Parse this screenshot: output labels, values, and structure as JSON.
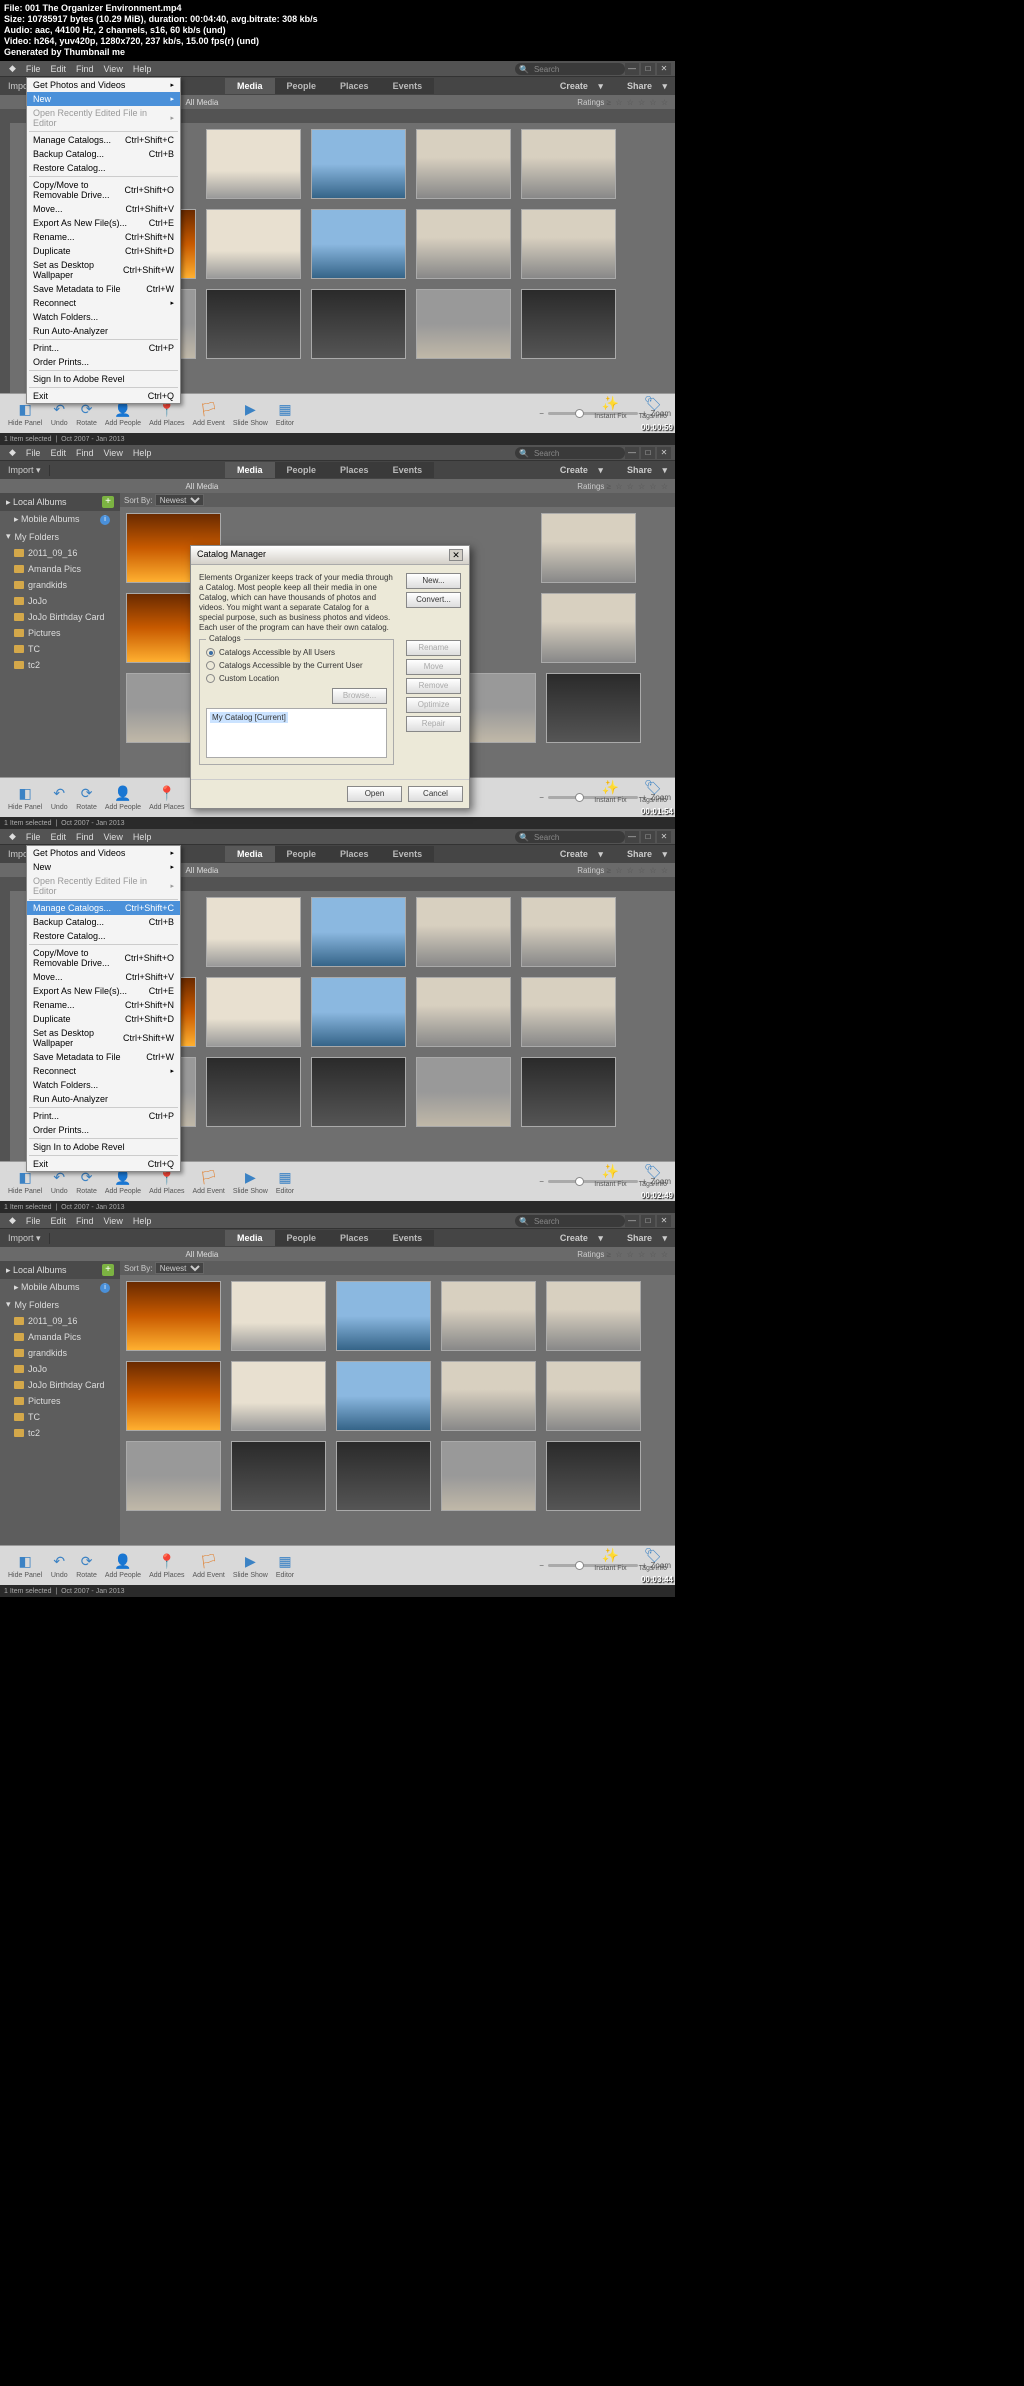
{
  "header": {
    "l1": "File: 001 The Organizer Environment.mp4",
    "l2": "Size: 10785917 bytes (10.29 MiB), duration: 00:04:40, avg.bitrate: 308 kb/s",
    "l3": "Audio: aac, 44100 Hz, 2 channels, s16, 60 kb/s (und)",
    "l4": "Video: h264, yuv420p, 1280x720, 237 kb/s, 15.00 fps(r) (und)",
    "l5": "Generated by Thumbnail me"
  },
  "menubar": {
    "file": "File",
    "edit": "Edit",
    "find": "Find",
    "view": "View",
    "help": "Help"
  },
  "search": {
    "placeholder": "Search"
  },
  "topbar": {
    "import": "Import",
    "create": "Create",
    "share": "Share"
  },
  "tabs": {
    "media": "Media",
    "people": "People",
    "places": "Places",
    "events": "Events"
  },
  "subbar": {
    "allmedia": "All Media",
    "ratings": "Ratings",
    "stars": "≥ ☆ ☆ ☆ ☆ ☆"
  },
  "sortby": {
    "label": "Sort By:",
    "value": "Newest"
  },
  "sidebar": {
    "local": "Local Albums",
    "mobile": "Mobile Albums",
    "myfolders": "My Folders",
    "items": [
      "2011_09_16",
      "Amanda Pics",
      "grandkids",
      "JoJo",
      "JoJo Birthday Card",
      "Pictures",
      "TC",
      "tc2"
    ]
  },
  "toolbar": {
    "hidepanel": "Hide Panel",
    "undo": "Undo",
    "rotate": "Rotate",
    "addpeople": "Add People",
    "addplaces": "Add Places",
    "addevent": "Add Event",
    "slideshow": "Slide Show",
    "editor": "Editor",
    "zoom": "Zoom",
    "instantfix": "Instant Fix",
    "tagsinfo": "Tags/Info"
  },
  "status": {
    "selected": "1 Item selected",
    "range": "Oct 2007 - Jan 2013"
  },
  "filemenu": {
    "getphotos": "Get Photos and Videos",
    "new": "New",
    "openrecent": "Open Recently Edited File in Editor",
    "manage": "Manage Catalogs...",
    "manage_sc": "Ctrl+Shift+C",
    "backup": "Backup Catalog...",
    "backup_sc": "Ctrl+B",
    "restore": "Restore Catalog...",
    "copymove": "Copy/Move to Removable Drive...",
    "copymove_sc": "Ctrl+Shift+O",
    "move": "Move...",
    "move_sc": "Ctrl+Shift+V",
    "export": "Export As New File(s)...",
    "export_sc": "Ctrl+E",
    "rename": "Rename...",
    "rename_sc": "Ctrl+Shift+N",
    "duplicate": "Duplicate",
    "duplicate_sc": "Ctrl+Shift+D",
    "wallpaper": "Set as Desktop Wallpaper",
    "wallpaper_sc": "Ctrl+Shift+W",
    "savemeta": "Save Metadata to File",
    "savemeta_sc": "Ctrl+W",
    "reconnect": "Reconnect",
    "watchfolders": "Watch Folders...",
    "autoanalyzer": "Run Auto-Analyzer",
    "print": "Print...",
    "print_sc": "Ctrl+P",
    "orderprints": "Order Prints...",
    "signin": "Sign In to Adobe Revel",
    "exit": "Exit",
    "exit_sc": "Ctrl+Q"
  },
  "dialog": {
    "title": "Catalog Manager",
    "desc": "Elements Organizer keeps track of your media through a Catalog.\nMost people keep all their media in one Catalog, which can have thousands of photos and videos. You might want a separate Catalog for a special purpose, such as business photos and videos. Each user of the program can have their own catalog.",
    "catalogs_legend": "Catalogs",
    "r1": "Catalogs Accessible by All Users",
    "r2": "Catalogs Accessible by the Current User",
    "r3": "Custom Location",
    "browse": "Browse...",
    "current": "My Catalog [Current]",
    "new": "New...",
    "convert": "Convert...",
    "rename": "Rename",
    "move": "Move",
    "remove": "Remove",
    "optimize": "Optimize",
    "repair": "Repair",
    "open": "Open",
    "cancel": "Cancel"
  },
  "ts": {
    "p1": "00:00:59",
    "p2": "00:01:54",
    "p3": "00:02:49",
    "p4": "00:03:44"
  }
}
